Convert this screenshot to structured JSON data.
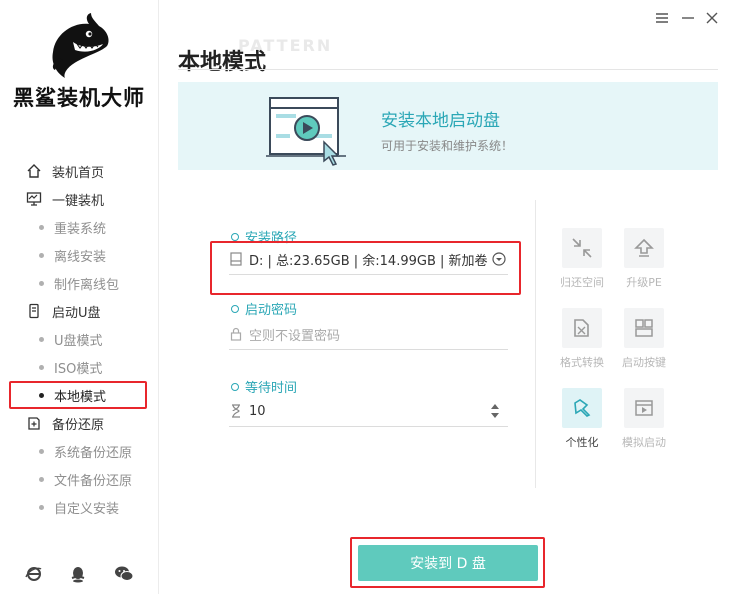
{
  "app": {
    "brand": "黑鲨装机大师",
    "window_controls": {
      "menu": "☰",
      "minimize": "—",
      "close": "✕"
    }
  },
  "sidebar": {
    "items": [
      {
        "label": "装机首页",
        "icon": "home-icon",
        "type": "main"
      },
      {
        "label": "一键装机",
        "icon": "monitor-icon",
        "type": "main"
      },
      {
        "label": "重装系统",
        "type": "sub"
      },
      {
        "label": "离线安装",
        "type": "sub"
      },
      {
        "label": "制作离线包",
        "type": "sub"
      },
      {
        "label": "启动U盘",
        "icon": "usb-icon",
        "type": "main"
      },
      {
        "label": "U盘模式",
        "type": "sub"
      },
      {
        "label": "ISO模式",
        "type": "sub"
      },
      {
        "label": "本地模式",
        "type": "sub",
        "active": true
      },
      {
        "label": "备份还原",
        "icon": "backup-icon",
        "type": "main"
      },
      {
        "label": "系统备份还原",
        "type": "sub"
      },
      {
        "label": "文件备份还原",
        "type": "sub"
      },
      {
        "label": "自定义安装",
        "type": "sub"
      }
    ],
    "social_icons": [
      "ie-icon",
      "qq-icon",
      "wechat-icon"
    ]
  },
  "main": {
    "title": "本地模式",
    "watermark": "PATTERN",
    "banner": {
      "title": "安装本地启动盘",
      "subtitle": "可用于安装和维护系统！"
    },
    "fields": {
      "path_label": "安装路径",
      "path_value": "D: | 总:23.65GB | 余:14.99GB | 新加卷",
      "password_label": "启动密码",
      "password_placeholder": "空则不设置密码",
      "wait_label": "等待时间",
      "wait_value": "10"
    },
    "tools": [
      {
        "label": "归还空间",
        "icon": "shrink-icon",
        "enabled": false
      },
      {
        "label": "升级PE",
        "icon": "upgrade-icon",
        "enabled": false
      },
      {
        "label": "格式转换",
        "icon": "convert-icon",
        "enabled": false
      },
      {
        "label": "启动按键",
        "icon": "keys-icon",
        "enabled": false
      },
      {
        "label": "个性化",
        "icon": "personalize-icon",
        "enabled": true
      },
      {
        "label": "模拟启动",
        "icon": "simulate-icon",
        "enabled": false
      }
    ],
    "install_button": "安装到 D 盘"
  },
  "colors": {
    "accent": "#2ba7b6",
    "button": "#5fcabd",
    "highlight_border": "#e8262c"
  }
}
